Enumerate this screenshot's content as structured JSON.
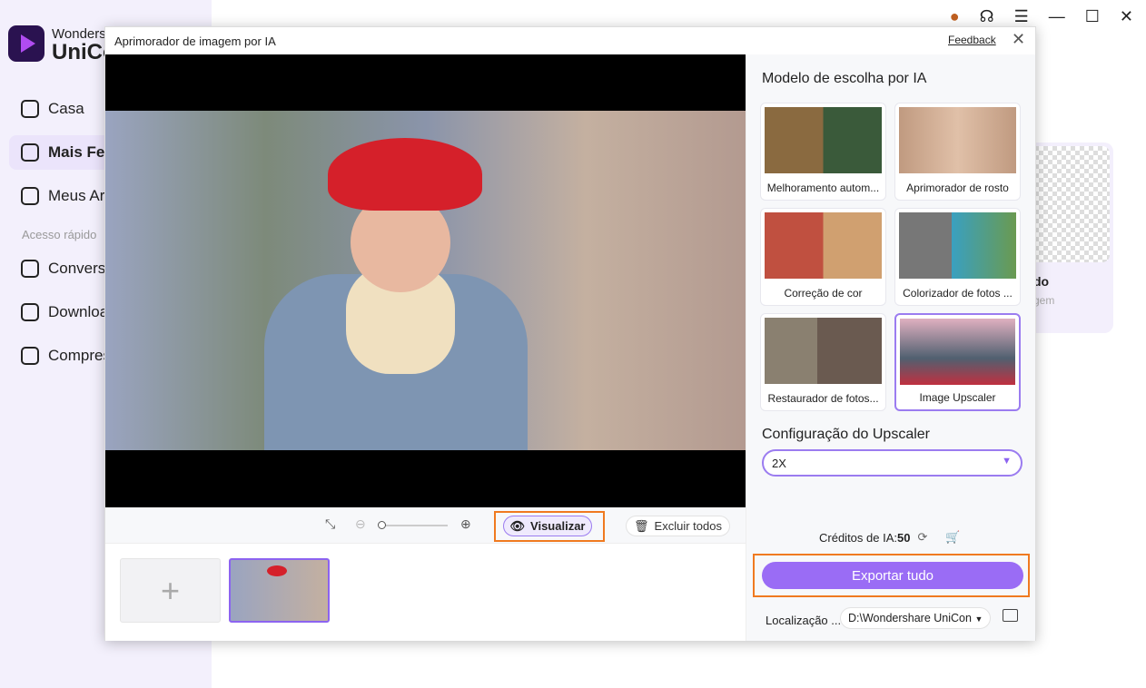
{
  "app": {
    "brand_line1": "Wonders",
    "brand_line2": "UniCo",
    "nav": [
      {
        "label": "Casa",
        "icon": "home-icon"
      },
      {
        "label": "Mais Fe",
        "icon": "toolbox-icon",
        "active": true
      },
      {
        "label": "Meus Arq",
        "icon": "files-icon"
      }
    ],
    "quick_access_label": "Acesso rápido",
    "quick": [
      {
        "label": "Converso",
        "icon": "convert-icon"
      },
      {
        "label": "Downloa",
        "icon": "download-icon"
      },
      {
        "label": "Compres",
        "icon": "compress-icon"
      }
    ],
    "bg_card": {
      "title": "do",
      "subtitle": "gem"
    }
  },
  "dialog": {
    "title": "Aprimorador de imagem por IA",
    "feedback": "Feedback",
    "toolbar": {
      "preview": "Visualizar",
      "delete_all": "Excluir todos",
      "zoom_level": 0
    },
    "panel": {
      "title": "Modelo de escolha por IA",
      "models": [
        {
          "label": "Melhoramento autom..."
        },
        {
          "label": "Aprimorador de rosto"
        },
        {
          "label": "Correção de cor"
        },
        {
          "label": "Colorizador de fotos ..."
        },
        {
          "label": "Restaurador de fotos..."
        },
        {
          "label": "Image Upscaler",
          "selected": true
        }
      ],
      "upscaler_title": "Configuração do Upscaler",
      "upscaler_value": "2X",
      "credits_label": "Créditos de IA:",
      "credits_value": "50",
      "export": "Exportar tudo",
      "location_label": "Localização ...",
      "location_value": "D:\\Wondershare UniCon"
    }
  },
  "colors": {
    "accent": "#9a6cf5",
    "highlight": "#f07a20"
  }
}
